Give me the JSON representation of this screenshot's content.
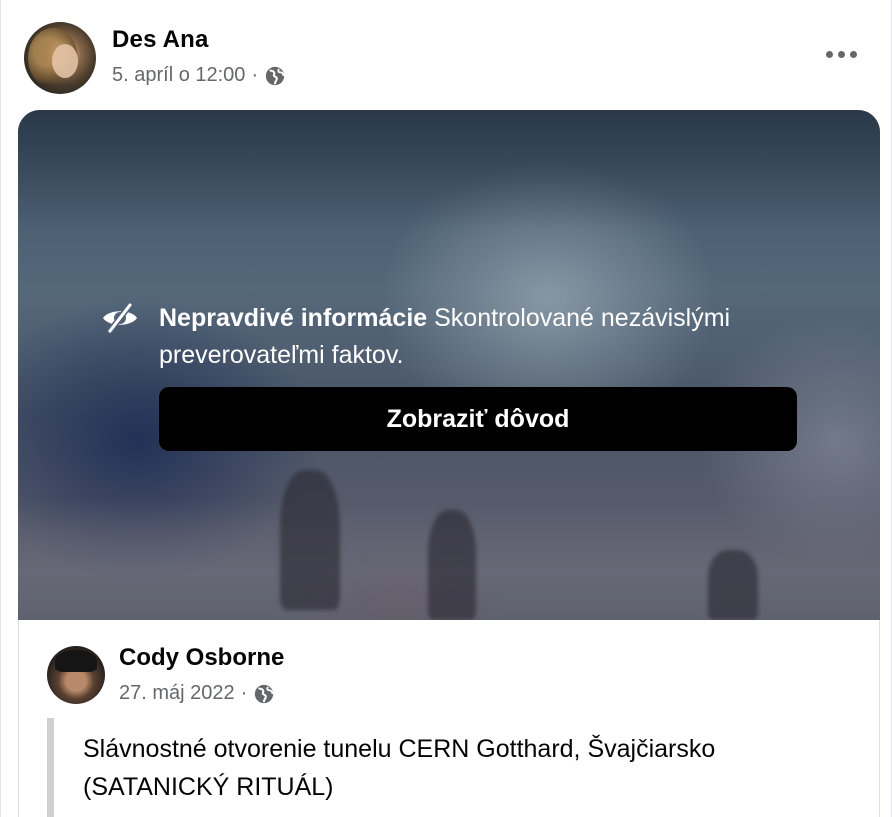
{
  "post": {
    "author": "Des Ana",
    "timestamp": "5. apríl o 12:00",
    "separator": "·",
    "privacy_icon": "globe-icon",
    "menu_icon": "more-options-icon"
  },
  "fact_check": {
    "icon": "eye-slash-icon",
    "label_bold": "Nepravdivé informácie",
    "label_rest": "Skontrolované nezávislými preverovateľmi faktov.",
    "button_label": "Zobraziť dôvod"
  },
  "shared_post": {
    "author": "Cody Osborne",
    "timestamp": "27. máj 2022",
    "separator": "·",
    "privacy_icon": "globe-icon",
    "text_line1": "Slávnostné otvorenie tunelu CERN Gotthard, Švajčiarsko",
    "text_line2": "(SATANICKÝ RITUÁL)"
  },
  "colors": {
    "secondary_text": "#65676b",
    "button_bg": "#000000",
    "quote_bar": "#ced0d4"
  }
}
